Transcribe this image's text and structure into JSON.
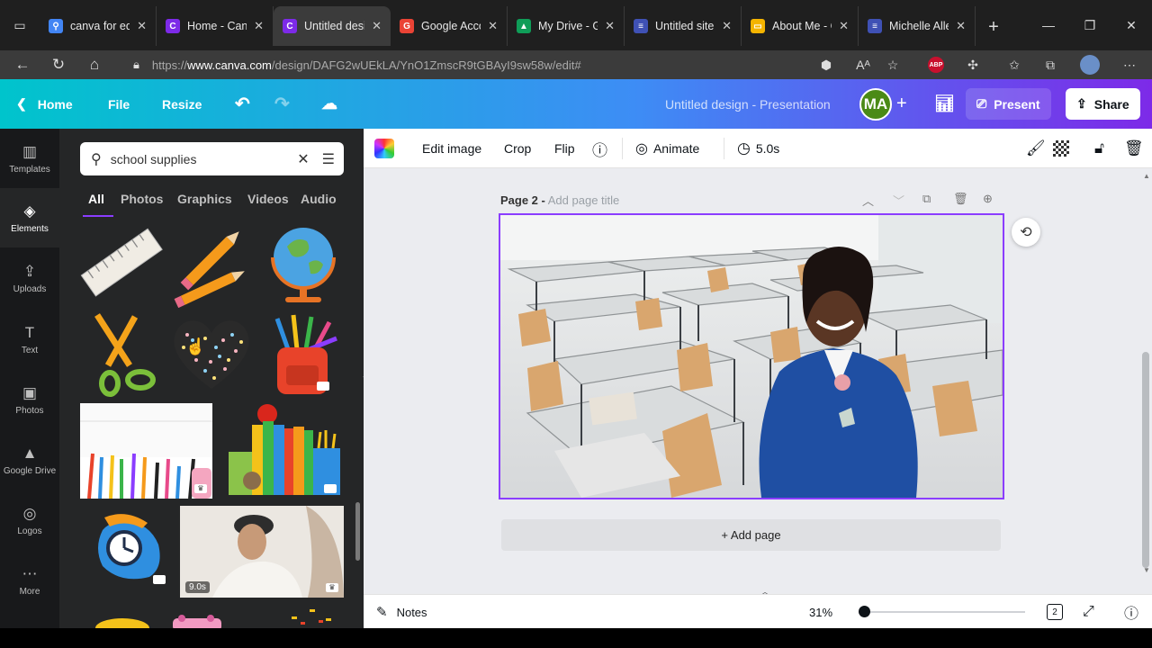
{
  "browser": {
    "tabs": [
      {
        "label": "canva for edu",
        "favicon": "search-icon",
        "color": "#4285f4",
        "active": false
      },
      {
        "label": "Home - Canva",
        "favicon": "canva-icon",
        "color": "#7d2ae8",
        "active": false
      },
      {
        "label": "Untitled design",
        "favicon": "canva-icon",
        "color": "#7d2ae8",
        "active": true
      },
      {
        "label": "Google Account",
        "favicon": "google-icon",
        "color": "#ea4335",
        "active": false
      },
      {
        "label": "My Drive - Google",
        "favicon": "drive-icon",
        "color": "#0f9d58",
        "active": false
      },
      {
        "label": "Untitled site",
        "favicon": "sites-icon",
        "color": "#3f51b5",
        "active": false
      },
      {
        "label": "About Me - Google",
        "favicon": "slides-icon",
        "color": "#f4b400",
        "active": false
      },
      {
        "label": "Michelle Allen",
        "favicon": "sites-icon",
        "color": "#3f51b5",
        "active": false
      }
    ],
    "url_prefix": "https://",
    "url_host": "www.canva.com",
    "url_path": "/design/DAFG2wUEkLA/YnO1ZmscR9tGBAyI9sw58w/edit#"
  },
  "header": {
    "home": "Home",
    "file": "File",
    "resize": "Resize",
    "title": "Untitled design - Presentation",
    "avatar": "MA",
    "present": "Present",
    "share": "Share"
  },
  "rail": [
    {
      "label": "Templates",
      "icon": "templates-icon"
    },
    {
      "label": "Elements",
      "icon": "elements-icon"
    },
    {
      "label": "Uploads",
      "icon": "upload-icon"
    },
    {
      "label": "Text",
      "icon": "text-icon"
    },
    {
      "label": "Photos",
      "icon": "photos-icon"
    },
    {
      "label": "Google Drive",
      "icon": "google-drive-icon"
    },
    {
      "label": "Logos",
      "icon": "logos-icon"
    },
    {
      "label": "More",
      "icon": "more-icon"
    }
  ],
  "panel": {
    "search_value": "school supplies",
    "tabs": [
      "All",
      "Photos",
      "Graphics",
      "Videos",
      "Audio"
    ],
    "video_duration": "9.0s"
  },
  "toolbar": {
    "edit_image": "Edit image",
    "crop": "Crop",
    "flip": "Flip",
    "animate": "Animate",
    "duration": "5.0s"
  },
  "page": {
    "label": "Page 2 -",
    "title_placeholder": "Add page title",
    "add_page": "+ Add page"
  },
  "footer": {
    "notes": "Notes",
    "zoom": "31%",
    "page_count": "2",
    "zoom_level": 0.31
  }
}
